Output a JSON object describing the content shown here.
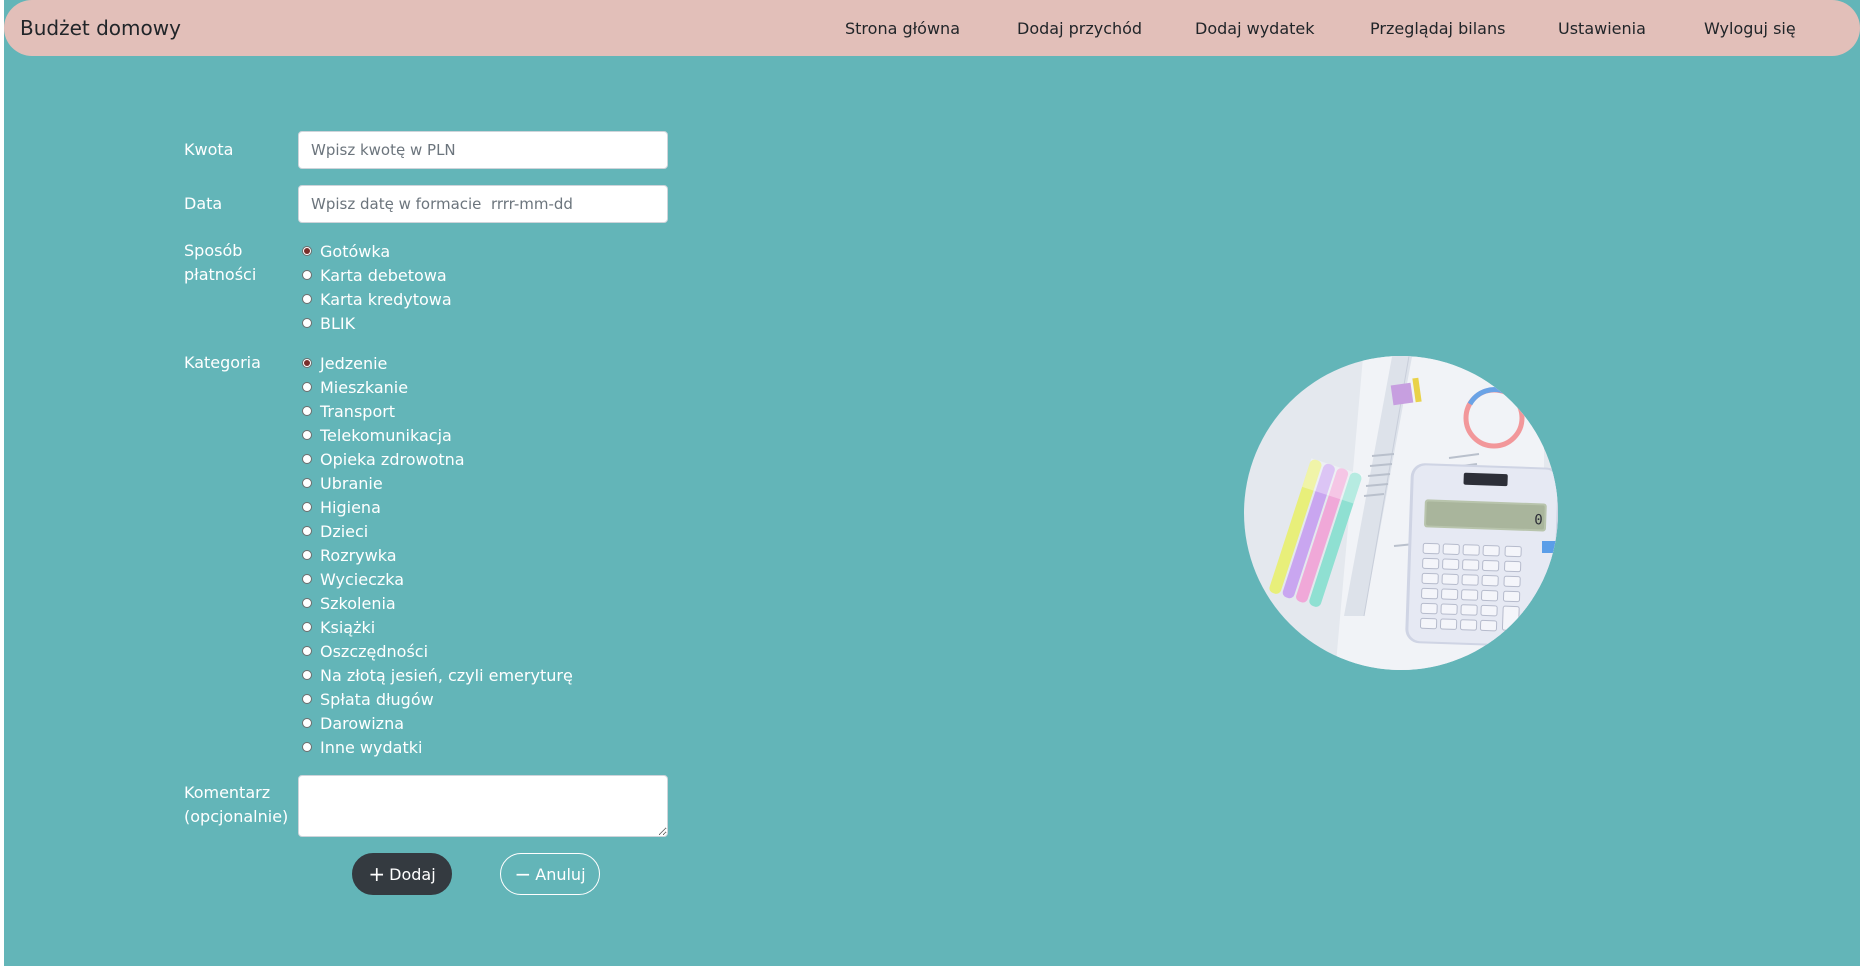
{
  "navbar": {
    "brand": "Budżet domowy",
    "links": [
      "Strona główna",
      "Dodaj przychód",
      "Dodaj wydatek",
      "Przeglądaj bilans",
      "Ustawienia",
      "Wyloguj się"
    ]
  },
  "form": {
    "amount": {
      "label": "Kwota",
      "placeholder": "Wpisz kwotę w PLN"
    },
    "date": {
      "label": "Data",
      "placeholder": "Wpisz datę w formacie  rrrr-mm-dd"
    },
    "payment": {
      "label_line1": "Sposób",
      "label_line2": "płatności",
      "options": [
        "Gotówka",
        "Karta debetowa",
        "Karta kredytowa",
        "BLIK"
      ],
      "selected": "Gotówka"
    },
    "category": {
      "label": "Kategoria",
      "options": [
        "Jedzenie",
        "Mieszkanie",
        "Transport",
        "Telekomunikacja",
        "Opieka zdrowotna",
        "Ubranie",
        "Higiena",
        "Dzieci",
        "Rozrywka",
        "Wycieczka",
        "Szkolenia",
        "Książki",
        "Oszczędności",
        "Na złotą jesień, czyli emeryturę",
        "Spłata długów",
        "Darowizna",
        "Inne wydatki"
      ],
      "selected": "Jedzenie"
    },
    "comment": {
      "label_line1": "Komentarz",
      "label_line2": "(opcjonalnie)",
      "value": ""
    },
    "buttons": {
      "add_label": "Dodaj",
      "add_icon": "+",
      "cancel_label": "Anuluj",
      "cancel_icon": "−"
    }
  },
  "colors": {
    "background": "#63b5b8",
    "navbar": "#e2bfb9",
    "add_button": "#343a40"
  },
  "image": {
    "subject": "calculator-and-documents-photo"
  }
}
